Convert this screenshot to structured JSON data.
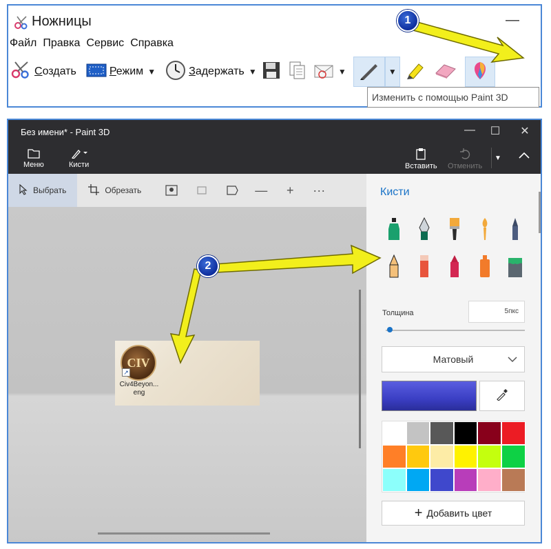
{
  "snipping_tool": {
    "title": "Ножницы",
    "minimize_glyph": "—",
    "menu": [
      "Файл",
      "Правка",
      "Сервис",
      "Справка"
    ],
    "toolbar": {
      "create_label": "Создать",
      "mode_label": "Режим",
      "delay_label": "Задержать"
    },
    "tooltip": "Изменить с помощью Paint 3D"
  },
  "paint3d": {
    "title": "Без имени* - Paint 3D",
    "window_controls": {
      "minimize": "—",
      "maximize": "☐",
      "close": "✕"
    },
    "header": {
      "menu_label": "Меню",
      "brushes_label": "Кисти",
      "paste_label": "Вставить",
      "undo_label": "Отменить"
    },
    "tools": {
      "select_label": "Выбрать",
      "crop_label": "Обрезать"
    },
    "canvas": {
      "icon_text": "CIV",
      "icon_label": "Civ4Beyon... eng"
    },
    "panel": {
      "title": "Кисти",
      "thickness_label": "Толщина",
      "thickness_value": "5пкс",
      "finish_label": "Матовый",
      "add_color_label": "Добавить цвет",
      "current_color": "#3b3fc4",
      "palette": [
        "#ffffff",
        "#c3c3c3",
        "#585858",
        "#000000",
        "#88001b",
        "#ec1c24",
        "#ff7f27",
        "#ffc90e",
        "#fdeca6",
        "#fff200",
        "#c4ff0e",
        "#0ed145",
        "#8cfffb",
        "#00a8f3",
        "#3f48cc",
        "#b83dba",
        "#ffaec9",
        "#b97a56"
      ]
    }
  },
  "annotations": {
    "badge_1": "1",
    "badge_2": "2",
    "arrow_color": "#f2ef1c"
  }
}
